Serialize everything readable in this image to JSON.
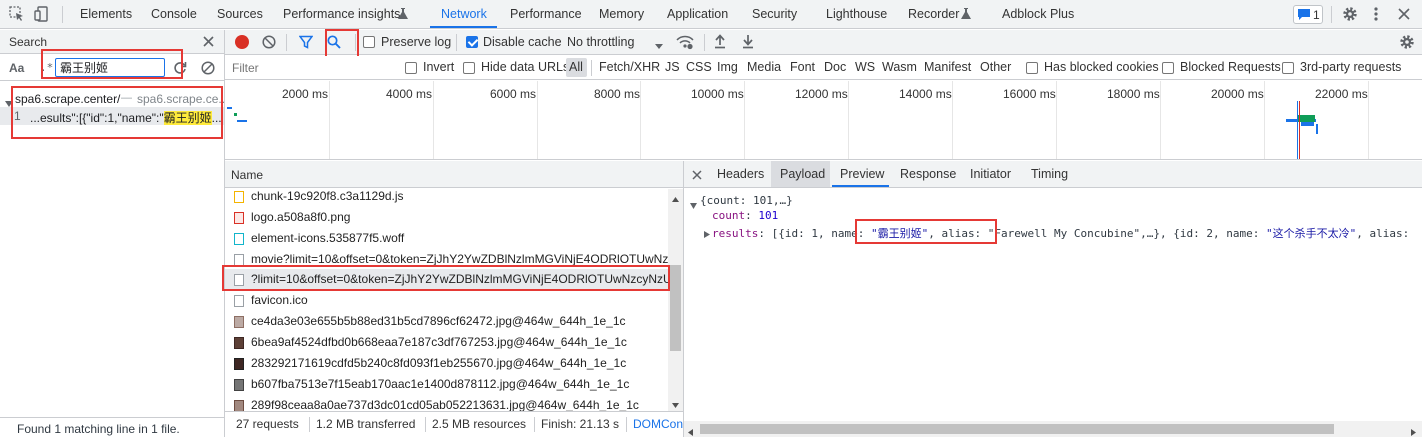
{
  "colors": {
    "accent": "#1a73e8",
    "record_red": "#d93025",
    "highlight": "#ffeb3b",
    "string": "#1a1aa6",
    "key": "#881280",
    "annotation_box": "#e53935"
  },
  "tabs": [
    {
      "label": "Elements"
    },
    {
      "label": "Console"
    },
    {
      "label": "Sources"
    },
    {
      "label": "Performance insights"
    },
    {
      "label": "Network"
    },
    {
      "label": "Performance"
    },
    {
      "label": "Memory"
    },
    {
      "label": "Application"
    },
    {
      "label": "Security"
    },
    {
      "label": "Lighthouse"
    },
    {
      "label": "Recorder"
    },
    {
      "label": "Adblock Plus"
    }
  ],
  "issues_badge": "1",
  "search": {
    "title": "Search",
    "case_label": "Aa",
    "regex_label": ".*",
    "query": "霸王别姬",
    "file_name": "spa6.scrape.center/",
    "file_path": "spa6.scrape.ce...",
    "line_number": "1",
    "match_prefix": "...esults\":[{\"id\":1,\"name\":\"",
    "match_text": "霸王别姬",
    "match_suffix": "...",
    "status": "Found 1 matching line in 1 file."
  },
  "toolbar": {
    "preserve_log": "Preserve log",
    "disable_cache": "Disable cache",
    "throttling": "No throttling"
  },
  "filter": {
    "placeholder": "Filter",
    "invert": "Invert",
    "hide_data_urls": "Hide data URLs",
    "types": [
      "All",
      "Fetch/XHR",
      "JS",
      "CSS",
      "Img",
      "Media",
      "Font",
      "Doc",
      "WS",
      "Wasm",
      "Manifest",
      "Other"
    ],
    "blocked_cookies": "Has blocked cookies",
    "blocked_requests": "Blocked Requests",
    "third_party": "3rd-party requests"
  },
  "timeline_ticks": [
    "2000 ms",
    "4000 ms",
    "6000 ms",
    "8000 ms",
    "10000 ms",
    "12000 ms",
    "14000 ms",
    "16000 ms",
    "18000 ms",
    "20000 ms",
    "22000 ms"
  ],
  "list": {
    "header": "Name",
    "rows": [
      {
        "name": "chunk-19c920f8.c3a1129d.js",
        "icon": "js-file-icon"
      },
      {
        "name": "logo.a508a8f0.png",
        "icon": "image-file-icon"
      },
      {
        "name": "element-icons.535877f5.woff",
        "icon": "font-file-icon"
      },
      {
        "name": "movie?limit=10&offset=0&token=ZjJhY2YwZDBlNzlmMGViNjE4ODRlOTUwNz",
        "icon": "document-icon"
      },
      {
        "name": "?limit=10&offset=0&token=ZjJhY2YwZDBlNzlmMGViNjE4ODRlOTUwNzcyNzU",
        "icon": "document-icon"
      },
      {
        "name": "favicon.ico",
        "icon": "document-icon"
      },
      {
        "name": "ce4da3e03e655b5b88ed31b5cd7896cf62472.jpg@464w_644h_1e_1c",
        "icon": "image-thumb-icon"
      },
      {
        "name": "6bea9af4524dfbd0b668eaa7e187c3df767253.jpg@464w_644h_1e_1c",
        "icon": "image-thumb-icon"
      },
      {
        "name": "283292171619cdfd5b240c8fd093f1eb255670.jpg@464w_644h_1e_1c",
        "icon": "image-thumb-icon"
      },
      {
        "name": "b607fba7513e7f15eab170aac1e1400d878112.jpg@464w_644h_1e_1c",
        "icon": "image-thumb-icon"
      },
      {
        "name": "289f98ceaa8a0ae737d3dc01cd05ab052213631.jpg@464w_644h_1e_1c",
        "icon": "image-thumb-icon"
      }
    ]
  },
  "status_bar": {
    "requests": "27 requests",
    "transferred": "1.2 MB transferred",
    "resources": "2.5 MB resources",
    "finish": "Finish: 21.13 s",
    "domcontent": "DOMCon"
  },
  "detail_tabs": [
    "Headers",
    "Payload",
    "Preview",
    "Response",
    "Initiator",
    "Timing"
  ],
  "preview": {
    "root_summary": "{count: 101,…}",
    "count_key": "count",
    "count_value": "101",
    "results_key": "results",
    "results_open": "[{id: 1, name: ",
    "name1": "\"霸王别姬\"",
    "alias_part": ", alias: \"Farewell My Concubine\",…}, {id: 2, name: ",
    "name2": "\"这个杀手不太冷\"",
    "tail": ", alias:"
  }
}
